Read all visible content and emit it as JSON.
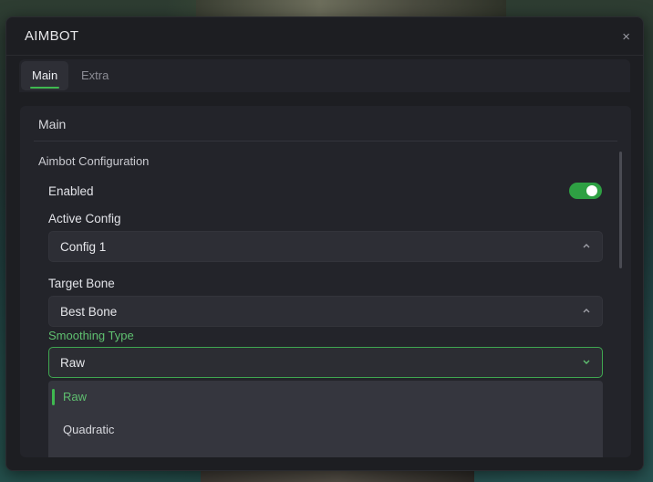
{
  "window": {
    "title": "AIMBOT",
    "close_glyph": "×"
  },
  "tabs": [
    {
      "label": "Main",
      "active": true
    },
    {
      "label": "Extra",
      "active": false
    }
  ],
  "panel": {
    "title": "Main",
    "group": "Aimbot Configuration",
    "enabled": {
      "label": "Enabled",
      "value": true
    },
    "active_config": {
      "label": "Active Config",
      "value": "Config 1",
      "icon": "chevron-up-icon"
    },
    "target_bone": {
      "label": "Target Bone",
      "value": "Best Bone",
      "icon": "chevron-up-icon"
    },
    "smoothing_type": {
      "label": "Smoothing Type",
      "value": "Raw",
      "icon": "chevron-down-icon",
      "options": [
        "Raw",
        "Quadratic"
      ]
    }
  },
  "colors": {
    "accent": "#3fb950",
    "window_bg": "#1d1e22",
    "panel_bg": "#23242a"
  }
}
